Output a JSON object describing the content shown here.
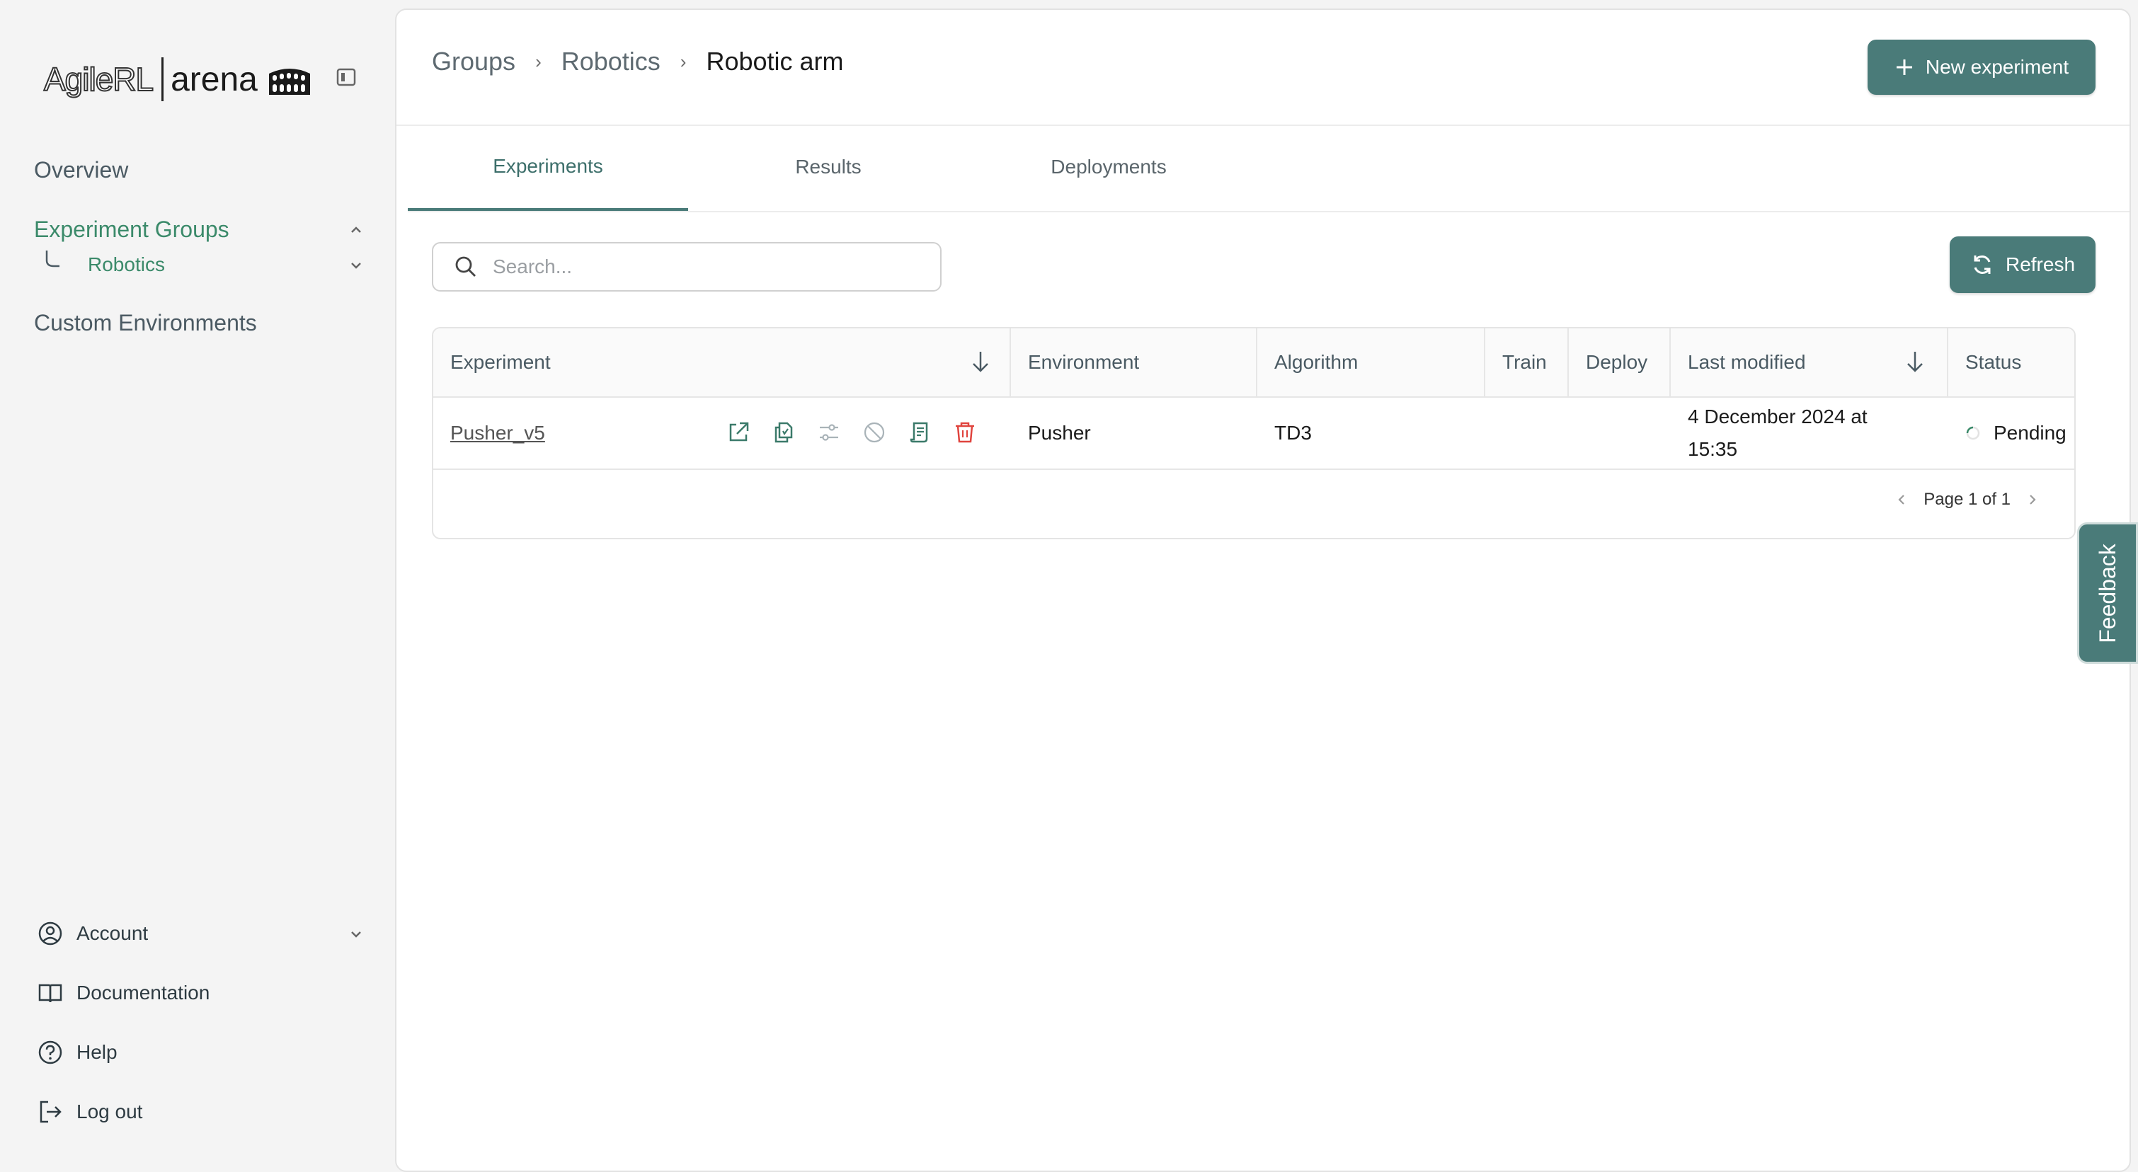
{
  "brand": {
    "name_left": "AgileRL",
    "name_right": "arena"
  },
  "sidebar": {
    "nav": {
      "overview": "Overview",
      "groups": "Experiment Groups",
      "group_sub": "Robotics",
      "custom": "Custom Environments"
    },
    "bottom": {
      "account": "Account",
      "documentation": "Documentation",
      "help": "Help",
      "logout": "Log out"
    }
  },
  "header": {
    "breadcrumbs": [
      "Groups",
      "Robotics",
      "Robotic arm"
    ],
    "new_experiment": "New experiment"
  },
  "tabs": [
    "Experiments",
    "Results",
    "Deployments"
  ],
  "search": {
    "placeholder": "Search...",
    "refresh": "Refresh"
  },
  "table": {
    "columns": [
      "Experiment",
      "Environment",
      "Algorithm",
      "Train",
      "Deploy",
      "Last modified",
      "Status"
    ],
    "rows": [
      {
        "experiment": "Pusher_v5",
        "environment": "Pusher",
        "algorithm": "TD3",
        "train": "",
        "deploy": "",
        "last_modified_line1": "4 December 2024 at",
        "last_modified_line2": "15:35",
        "status": "Pending"
      }
    ],
    "pagination": "Page 1 of 1"
  },
  "feedback": "Feedback",
  "colors": {
    "accent": "#4a7b79",
    "active_nav": "#3b8a6a",
    "delete": "#e0443e"
  },
  "icons": [
    "colosseum-icon",
    "sidebar-toggle-icon",
    "chevron-up-icon",
    "chevron-down-icon",
    "user-icon",
    "book-icon",
    "help-icon",
    "logout-icon",
    "plus-icon",
    "search-icon",
    "refresh-icon",
    "sort-down-icon",
    "open-external-icon",
    "copy-icon",
    "settings-icon",
    "stop-icon",
    "logs-icon",
    "trash-icon",
    "spinner-icon",
    "chevron-left-icon",
    "chevron-right-icon"
  ]
}
